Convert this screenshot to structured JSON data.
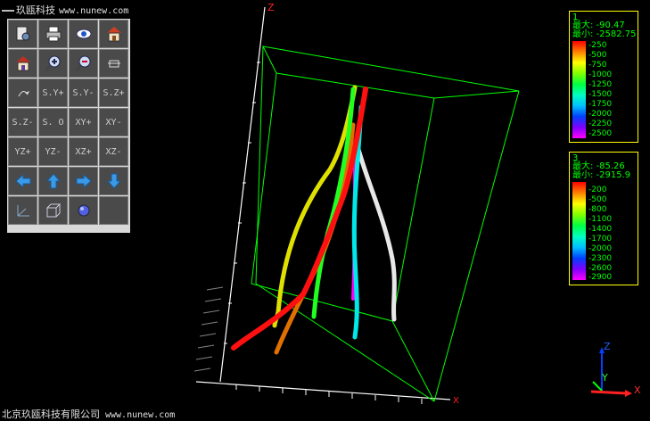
{
  "header": {
    "company": "玖瓯科技",
    "url": "www.nunew.com"
  },
  "footer": {
    "company": "北京玖瓯科技有限公司",
    "url": "www.nunew.com"
  },
  "toolbar": {
    "buttons": [
      {
        "icon": "settings-page-icon"
      },
      {
        "icon": "print-icon"
      },
      {
        "icon": "eye-icon"
      },
      {
        "icon": "home-icon"
      },
      {
        "icon": "home-alt-icon"
      },
      {
        "icon": "zoom-in-icon"
      },
      {
        "icon": "zoom-out-icon"
      },
      {
        "icon": "axis-move-icon"
      },
      {
        "icon": "rotate-icon"
      },
      {
        "label": "S.Y+"
      },
      {
        "label": "S.Y-"
      },
      {
        "label": "S.Z+"
      },
      {
        "label": "S.Z-"
      },
      {
        "label": "S. O"
      },
      {
        "label": "XY+"
      },
      {
        "label": "XY-"
      },
      {
        "label": "YZ+"
      },
      {
        "label": "YZ-"
      },
      {
        "label": "XZ+"
      },
      {
        "label": "XZ-"
      },
      {
        "icon": "arrow-left-icon"
      },
      {
        "icon": "arrow-up-icon"
      },
      {
        "icon": "arrow-right-icon"
      },
      {
        "icon": "arrow-down-icon"
      },
      {
        "icon": "axes-icon"
      },
      {
        "icon": "cube-icon"
      },
      {
        "icon": "sphere-icon"
      },
      {
        "icon": "blank"
      }
    ]
  },
  "legends": [
    {
      "index": "1",
      "max": "最大: -90.47",
      "min": "最小: -2582.75",
      "ticks": [
        "-250",
        "-500",
        "-750",
        "-1000",
        "-1250",
        "-1500",
        "-1750",
        "-2000",
        "-2250",
        "-2500"
      ],
      "colors": [
        "#ff0000",
        "#ff8000",
        "#ffff00",
        "#80ff00",
        "#00ff40",
        "#00ffc0",
        "#00c0ff",
        "#0040ff",
        "#8000ff",
        "#ff00ff"
      ]
    },
    {
      "index": "3",
      "max": "最大: -85.26",
      "min": "最小: -2915.9",
      "ticks": [
        "-200",
        "-500",
        "-800",
        "-1100",
        "-1400",
        "-1700",
        "-2000",
        "-2300",
        "-2600",
        "-2900"
      ],
      "colors": [
        "#ff0000",
        "#ff8000",
        "#ffff00",
        "#80ff00",
        "#00ff40",
        "#00ffc0",
        "#00c0ff",
        "#0040ff",
        "#8000ff",
        "#ff00ff"
      ]
    }
  ],
  "scene": {
    "axis_labels": {
      "z": "Z",
      "x": "X"
    },
    "box_color": "#00ff00",
    "wells": [
      {
        "name": "well-yellow",
        "color": "#ffff00"
      },
      {
        "name": "well-orange",
        "color": "#ff8000"
      },
      {
        "name": "well-red",
        "color": "#ff0000"
      },
      {
        "name": "well-green",
        "color": "#00ff00"
      },
      {
        "name": "well-cyan",
        "color": "#00ffff"
      },
      {
        "name": "well-white",
        "color": "#ffffff"
      },
      {
        "name": "well-magenta",
        "color": "#ff00ff"
      }
    ]
  },
  "triad": {
    "z": "Z",
    "y": "Y",
    "x": "X"
  }
}
